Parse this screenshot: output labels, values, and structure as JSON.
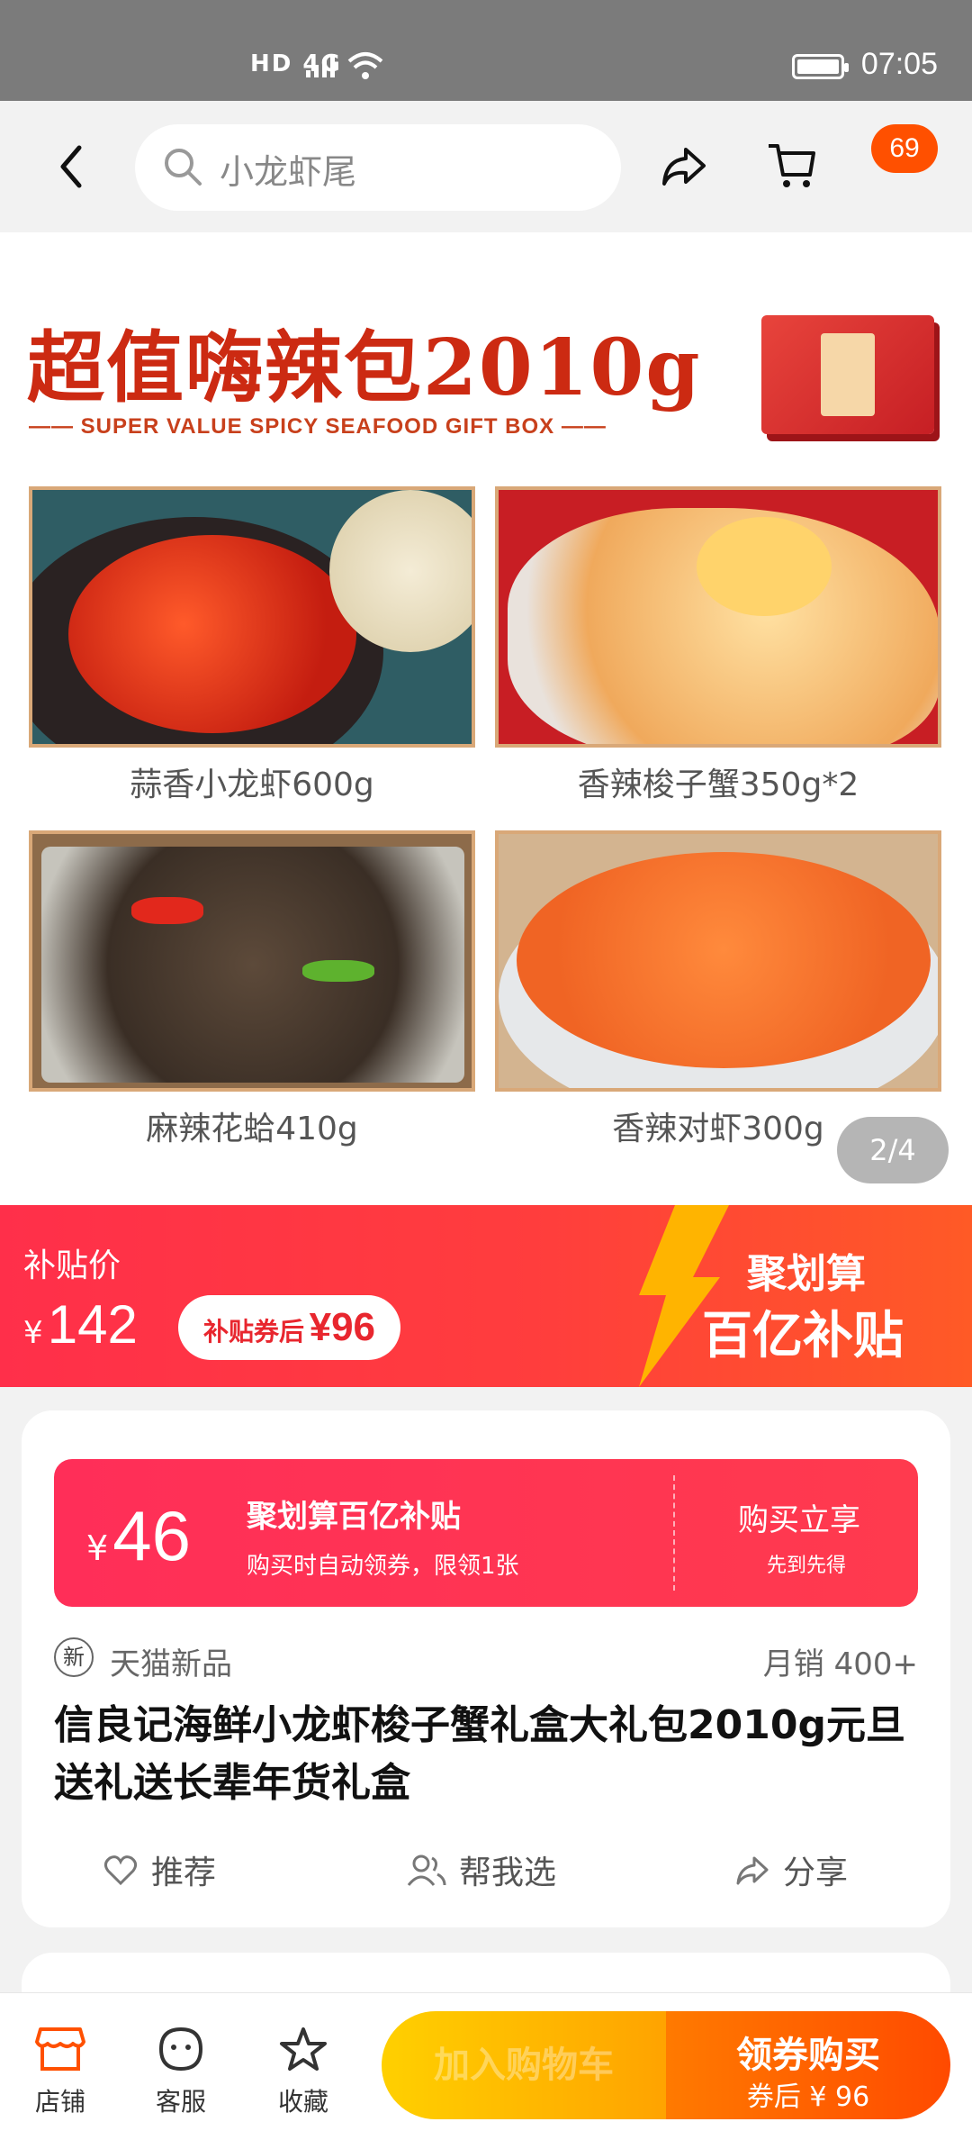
{
  "status_bar": {
    "network": "HD 4G",
    "time": "07:05"
  },
  "nav": {
    "search_placeholder": "小龙虾尾",
    "cart_badge": "69"
  },
  "hero": {
    "title": "超值嗨辣包2010g",
    "subtitle": "—— SUPER VALUE SPICY SEAFOOD GIFT BOX ——",
    "items": [
      {
        "caption": "蒜香小龙虾600g"
      },
      {
        "caption": "香辣梭子蟹350g*2"
      },
      {
        "caption": "麻辣花蛤410g"
      },
      {
        "caption": "香辣对虾300g"
      }
    ],
    "counter": "2/4"
  },
  "price_banner": {
    "label": "补贴价",
    "currency": "¥",
    "price": "142",
    "coupon_prefix": "补贴券后",
    "coupon_price": "¥96",
    "promo_line1": "聚划算",
    "promo_line2": "百亿补贴"
  },
  "card": {
    "coupon": {
      "currency": "¥",
      "amount": "46",
      "title": "聚划算百亿补贴",
      "desc": "购买时自动领券，限领1张",
      "cta": "购买立享",
      "cta_sub": "先到先得"
    },
    "new_tag": "新",
    "new_label": "天猫新品",
    "monthly_sales": "月销 400+",
    "title": "信良记海鲜小龙虾梭子蟹礼盒大礼包2010g元旦送礼送长辈年货礼盒",
    "actions": {
      "recommend": "推荐",
      "help_choose": "帮我选",
      "share": "分享"
    }
  },
  "bottom_bar": {
    "store": "店铺",
    "service": "客服",
    "favorite": "收藏",
    "add_cart": "加入购物车",
    "buy": "领券购买",
    "buy_sub": "券后 ¥ 96"
  }
}
